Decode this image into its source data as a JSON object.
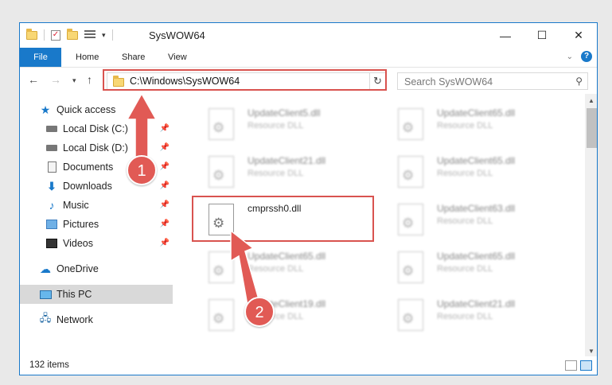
{
  "window": {
    "title": "SysWOW64"
  },
  "ribbon": {
    "tabs": [
      "File",
      "Home",
      "Share",
      "View"
    ],
    "help_label": "?"
  },
  "nav": {
    "address": "C:\\Windows\\SysWOW64",
    "search_placeholder": "Search SysWOW64"
  },
  "sidebar": {
    "items": [
      {
        "label": "Quick access",
        "icon": "star-icon"
      },
      {
        "label": "Local Disk (C:)",
        "icon": "disk-icon",
        "pinned": true
      },
      {
        "label": "Local Disk (D:)",
        "icon": "disk-icon",
        "pinned": true
      },
      {
        "label": "Documents",
        "icon": "documents-icon",
        "pinned": true
      },
      {
        "label": "Downloads",
        "icon": "downloads-icon",
        "pinned": true
      },
      {
        "label": "Music",
        "icon": "music-icon",
        "pinned": true
      },
      {
        "label": "Pictures",
        "icon": "pictures-icon",
        "pinned": true
      },
      {
        "label": "Videos",
        "icon": "videos-icon",
        "pinned": true
      },
      {
        "label": "OneDrive",
        "icon": "cloud-icon"
      },
      {
        "label": "This PC",
        "icon": "pc-icon",
        "selected": true
      },
      {
        "label": "Network",
        "icon": "network-icon"
      }
    ]
  },
  "files": [
    {
      "name": "UpdateClient5.dll",
      "type": "Resource DLL"
    },
    {
      "name": "UpdateClient65.dll",
      "type": "Resource DLL"
    },
    {
      "name": "UpdateClient21.dll",
      "type": "Resource DLL"
    },
    {
      "name": "UpdateClient65.dll",
      "type": "Resource DLL"
    },
    {
      "name": "cmprssh0.dll",
      "type": ""
    },
    {
      "name": "UpdateClient63.dll",
      "type": "Resource DLL"
    },
    {
      "name": "UpdateClient65.dll",
      "type": "Resource DLL"
    },
    {
      "name": "UpdateClient65.dll",
      "type": "Resource DLL"
    },
    {
      "name": "UpdateClient19.dll",
      "type": "Resource DLL"
    },
    {
      "name": "UpdateClient21.dll",
      "type": "Resource DLL"
    }
  ],
  "status": {
    "item_count": "132 items"
  },
  "annotations": {
    "callout_1": "1",
    "callout_2": "2",
    "accent_color": "#e15a55"
  }
}
